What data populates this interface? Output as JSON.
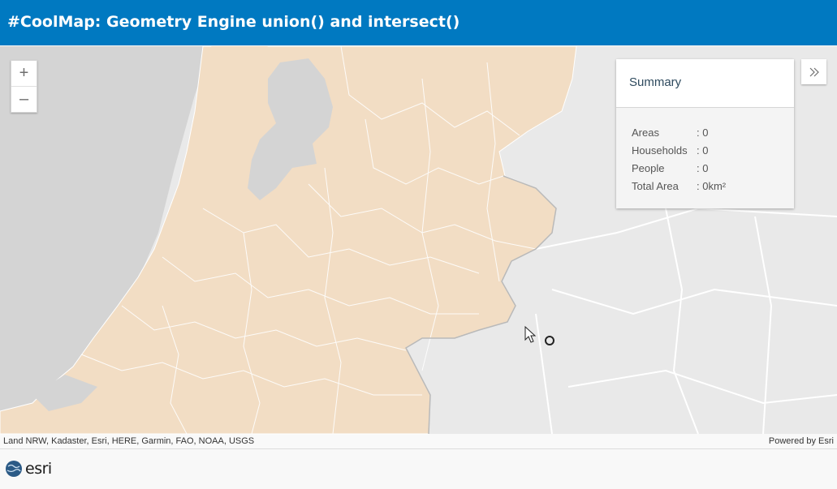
{
  "header": {
    "title": "#CoolMap: Geometry Engine union() and intersect()"
  },
  "zoom": {
    "in_label": "+",
    "out_label": "–"
  },
  "summary": {
    "title": "Summary",
    "rows": [
      {
        "label": "Areas",
        "value": ": 0"
      },
      {
        "label": "Households",
        "value": ": 0"
      },
      {
        "label": "People",
        "value": ": 0"
      },
      {
        "label": "Total Area",
        "value": ": 0km²"
      }
    ]
  },
  "attribution": {
    "sources": "Land NRW, Kadaster, Esri, HERE, Garmin, FAO, NOAA, USGS",
    "powered_by": "Powered by Esri"
  },
  "footer": {
    "logo_text": "esri"
  },
  "icons": {
    "expand": "chevrons-right-icon",
    "cursor": "mouse-pointer-icon",
    "marker": "circle-marker-icon",
    "globe": "esri-globe-icon"
  },
  "colors": {
    "header": "#0079c1",
    "land": "#f2ddc4",
    "sea": "#d4d4d4",
    "neighbor": "#ececec",
    "boundary": "#ffffff"
  }
}
